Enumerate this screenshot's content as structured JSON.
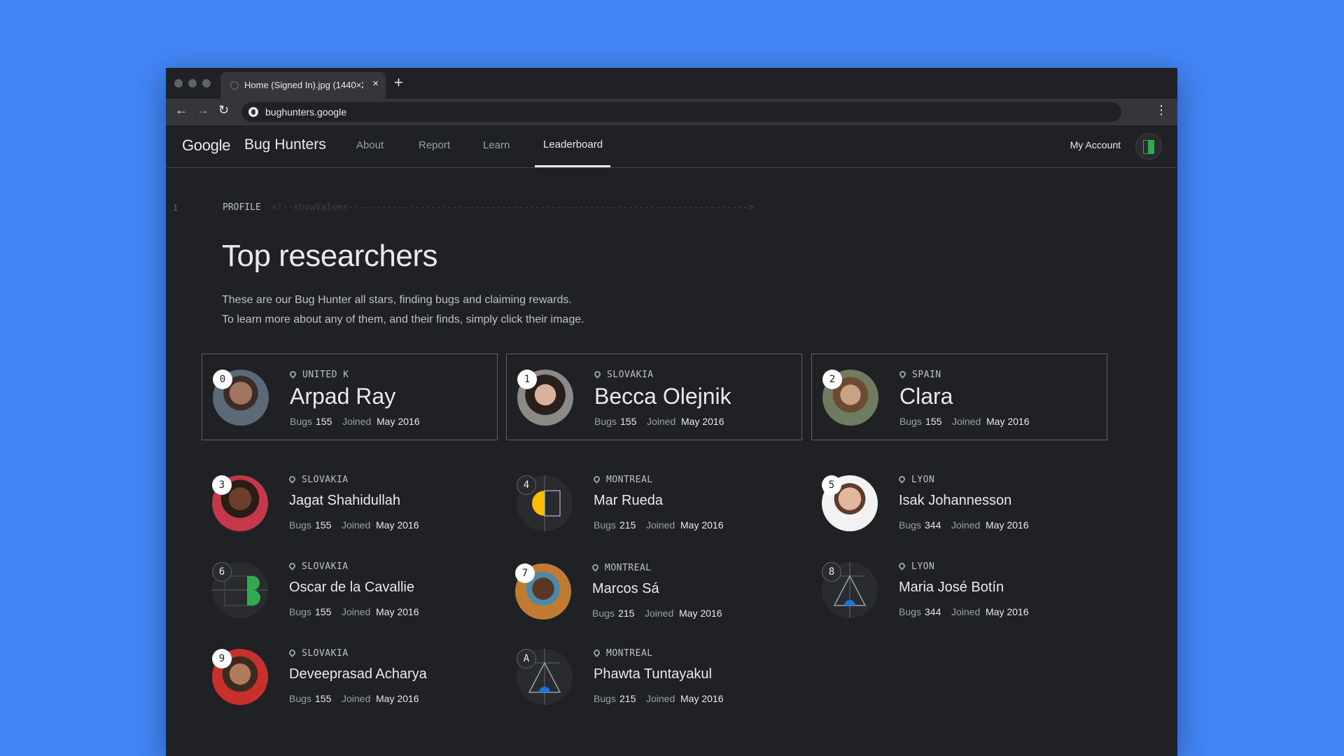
{
  "browser": {
    "tab_title": "Home (Signed In).jpg (1440×2",
    "close_symbol": "×",
    "new_tab_symbol": "+",
    "url": "bughunters.google"
  },
  "site": {
    "brand_google": "Google",
    "brand_product": "Bug Hunters",
    "nav": [
      "About",
      "Report",
      "Learn",
      "Leaderboard"
    ],
    "active_nav": "Leaderboard",
    "account_label": "My Account"
  },
  "content": {
    "line_number": "1",
    "profile_label": "PROFILE",
    "profile_comment": "<!--showValues------------------------------------------------------------------------->",
    "title": "Top researchers",
    "description_lines": [
      "These are our Bug Hunter all stars, finding bugs and claiming rewards.",
      "To learn more about any of them, and their finds, simply click their image."
    ],
    "stat_bugs_label": "Bugs",
    "stat_joined_label": "Joined"
  },
  "colors": {
    "background": "#4285f4",
    "page": "#202124",
    "accent_green": "#34a853",
    "accent_yellow": "#fbbc04",
    "accent_blue": "#1a73e8"
  },
  "researchers": [
    {
      "rank": "0",
      "location": "UNITED K",
      "name": "Arpad Ray",
      "bugs": "155",
      "joined": "May 2016",
      "avatar": "photo"
    },
    {
      "rank": "1",
      "location": "SLOVAKIA",
      "name": "Becca Olejnik",
      "bugs": "155",
      "joined": "May 2016",
      "avatar": "photo"
    },
    {
      "rank": "2",
      "location": "SPAIN",
      "name": "Clara",
      "bugs": "155",
      "joined": "May 2016",
      "avatar": "photo"
    },
    {
      "rank": "3",
      "location": "SLOVAKIA",
      "name": "Jagat Shahidullah",
      "bugs": "155",
      "joined": "May 2016",
      "avatar": "photo"
    },
    {
      "rank": "4",
      "location": "MONTREAL",
      "name": "Mar Rueda",
      "bugs": "215",
      "joined": "May 2016",
      "avatar": "yellow-shape-icon"
    },
    {
      "rank": "5",
      "location": "LYON",
      "name": "Isak Johannesson",
      "bugs": "344",
      "joined": "May 2016",
      "avatar": "photo"
    },
    {
      "rank": "6",
      "location": "SLOVAKIA",
      "name": "Oscar de la Cavallie",
      "bugs": "155",
      "joined": "May 2016",
      "avatar": "green-shape-icon"
    },
    {
      "rank": "7",
      "location": "MONTREAL",
      "name": "Marcos Sá",
      "bugs": "215",
      "joined": "May 2016",
      "avatar": "photo"
    },
    {
      "rank": "8",
      "location": "LYON",
      "name": "Maria José Botín",
      "bugs": "344",
      "joined": "May 2016",
      "avatar": "blue-triangle-icon"
    },
    {
      "rank": "9",
      "location": "SLOVAKIA",
      "name": "Deveeprasad Acharya",
      "bugs": "155",
      "joined": "May 2016",
      "avatar": "photo"
    },
    {
      "rank": "A",
      "location": "MONTREAL",
      "name": "Phawta Tuntayakul",
      "bugs": "215",
      "joined": "May 2016",
      "avatar": "blue-triangle-icon"
    }
  ]
}
